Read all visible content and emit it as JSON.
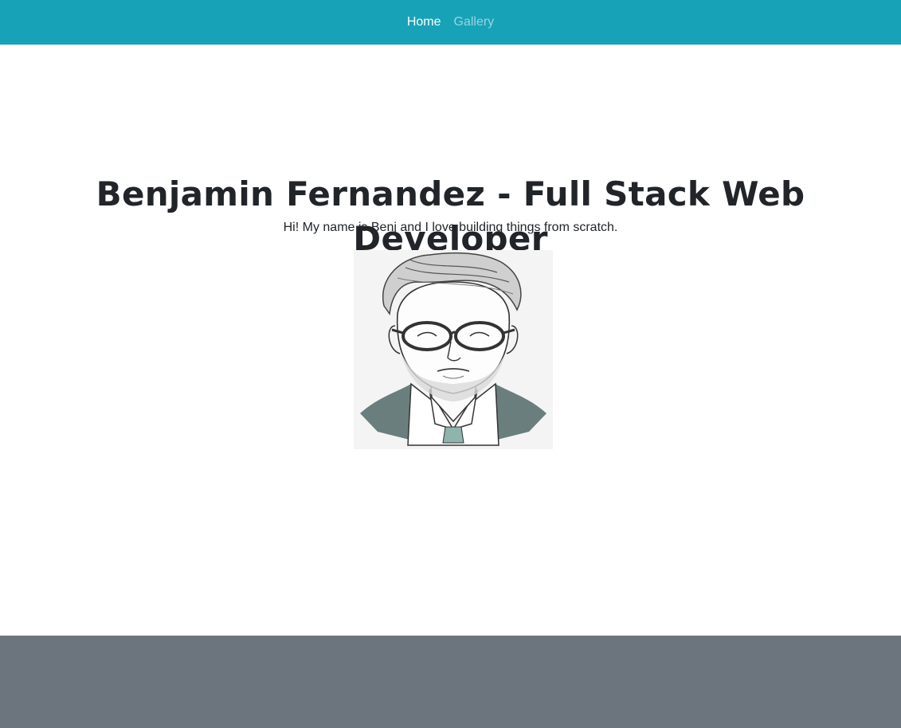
{
  "nav": {
    "items": [
      {
        "label": "Home",
        "active": true
      },
      {
        "label": "Gallery",
        "active": false
      }
    ]
  },
  "hero": {
    "title": "Benjamin Fernandez - Full Stack Web Developer",
    "subtitle": "Hi! My name is Benj and I love building things from scratch."
  },
  "colors": {
    "navbar_bg": "#17a2b8",
    "footer_bg": "#6c757d",
    "text": "#212529"
  }
}
